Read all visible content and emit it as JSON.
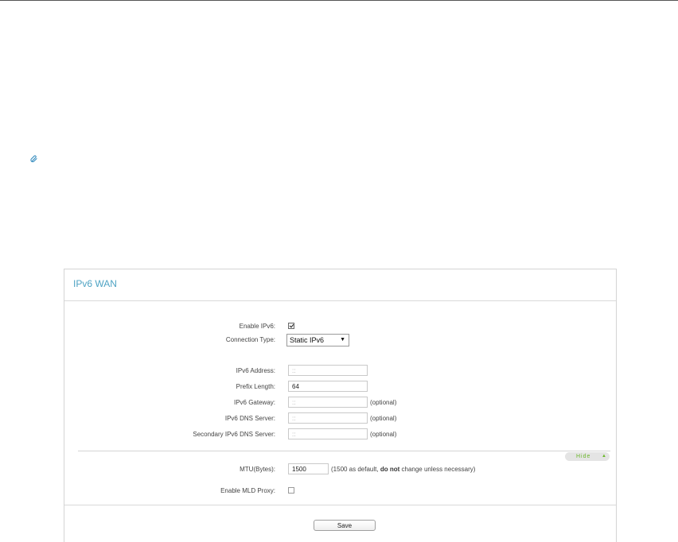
{
  "page": {
    "note_icon": "paperclip-icon"
  },
  "panel": {
    "title": "IPv6 WAN",
    "enable_ipv6": {
      "label": "Enable IPv6:",
      "checked": true
    },
    "connection_type": {
      "label": "Connection Type:",
      "value": "Static IPv6",
      "caret": "▼"
    },
    "ipv6_address": {
      "label": "IPv6 Address:",
      "placeholder": "::",
      "value": ""
    },
    "prefix_length": {
      "label": "Prefix Length:",
      "value": "64"
    },
    "ipv6_gateway": {
      "label": "IPv6 Gateway:",
      "placeholder": "::",
      "value": "",
      "hint": "(optional)"
    },
    "ipv6_dns": {
      "label": "IPv6 DNS Server:",
      "placeholder": "::",
      "value": "",
      "hint": "(optional)"
    },
    "secondary_ipv6_dns": {
      "label": "Secondary IPv6 DNS Server:",
      "placeholder": "::",
      "value": "",
      "hint": "(optional)"
    },
    "advanced_toggle": {
      "label": "Hide",
      "arrow": "▲",
      "color": "#6bb82a"
    },
    "mtu": {
      "label": "MTU(Bytes):",
      "value": "1500",
      "note_prefix": "(1500 as default, ",
      "note_bold": "do not",
      "note_suffix": " change unless necessary)"
    },
    "mld_proxy": {
      "label": "Enable MLD Proxy:",
      "checked": false
    },
    "save_label": "Save"
  },
  "colors": {
    "title": "#4fa3c3",
    "accent": "#6bb82a",
    "border": "#d4d4d4"
  }
}
